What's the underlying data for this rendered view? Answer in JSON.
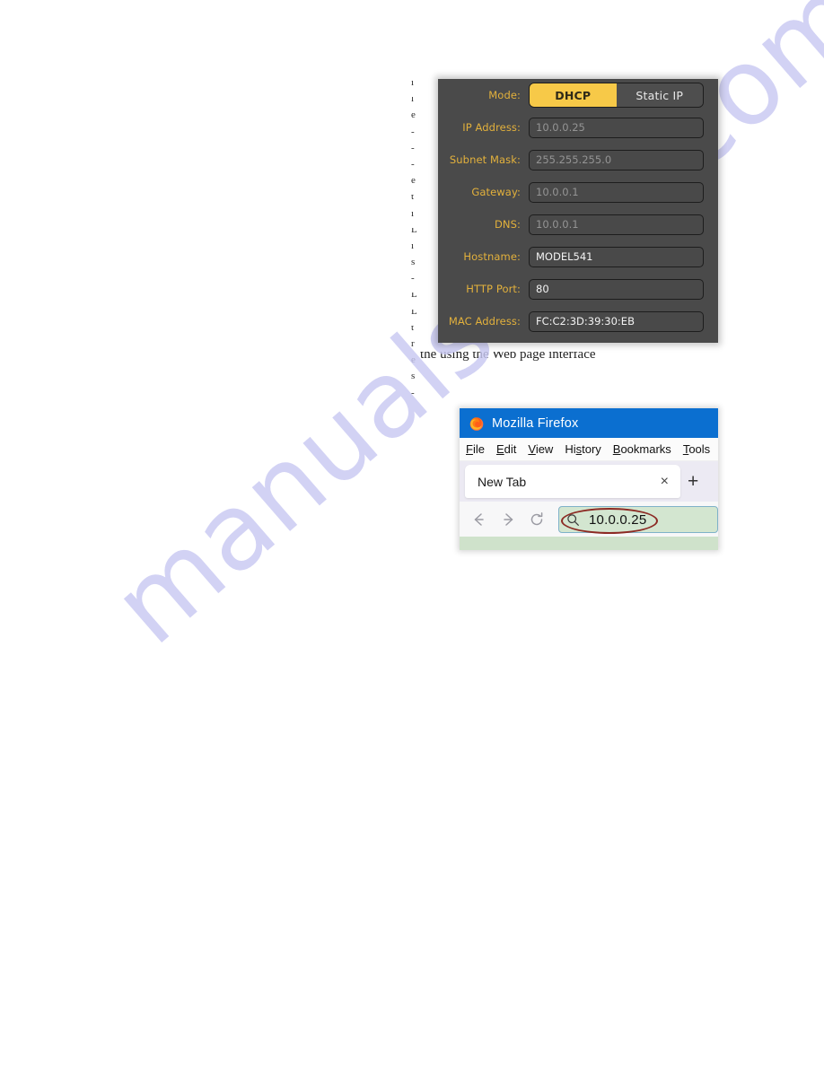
{
  "page": {
    "watermark": "manualshive.com",
    "background": "#ffffff"
  },
  "colors": {
    "panel_bg": "#4a4a4a",
    "label_amber": "#e3b13c",
    "active_toggle": "#f7c948",
    "firefox_titlebar_blue": "#0b6fd0",
    "urlbar_green": "#d3e6d0",
    "annotation_red": "#8c2a23"
  },
  "network_panel": {
    "name": "network-settings-panel",
    "mode": {
      "label": "Mode:",
      "options": [
        "DHCP",
        "Static IP"
      ],
      "selected": "DHCP"
    },
    "fields": [
      {
        "label": "IP Address:",
        "value": "10.0.0.25",
        "state": "disabled"
      },
      {
        "label": "Subnet Mask:",
        "value": "255.255.255.0",
        "state": "disabled"
      },
      {
        "label": "Gateway:",
        "value": "10.0.0.1",
        "state": "disabled"
      },
      {
        "label": "DNS:",
        "value": "10.0.0.1",
        "state": "disabled"
      },
      {
        "label": "Hostname:",
        "value": "MODEL541",
        "state": "editable"
      },
      {
        "label": "HTTP Port:",
        "value": "80",
        "state": "editable"
      },
      {
        "label": "MAC Address:",
        "value": "FC:C2:3D:39:30:EB",
        "state": "editable"
      }
    ]
  },
  "firefox": {
    "title": "Mozilla Firefox",
    "menu": [
      {
        "pre": "",
        "ak": "F",
        "post": "ile"
      },
      {
        "pre": "",
        "ak": "E",
        "post": "dit"
      },
      {
        "pre": "",
        "ak": "V",
        "post": "iew"
      },
      {
        "pre": "Hi",
        "ak": "s",
        "post": "tory"
      },
      {
        "pre": "",
        "ak": "B",
        "post": "ookmarks"
      },
      {
        "pre": "",
        "ak": "T",
        "post": "ools"
      }
    ],
    "tab": {
      "title": "New Tab",
      "close_label": "×",
      "new_tab_label": "+"
    },
    "nav": {
      "back": "back-arrow",
      "forward": "forward-arrow",
      "reload": "reload-arrow"
    },
    "urlbar": {
      "value": "10.0.0.25",
      "search_icon": "search-icon",
      "annotated": true
    }
  },
  "doc_fragments": {
    "left_column": [
      "i",
      "l",
      "e",
      "-",
      "-",
      "-",
      "e",
      "t",
      "i",
      "L",
      "i",
      "s",
      "-",
      "L",
      "L",
      "t",
      "r",
      "e",
      "s",
      "-"
    ],
    "bottom_row": "the using the Web page interface"
  }
}
